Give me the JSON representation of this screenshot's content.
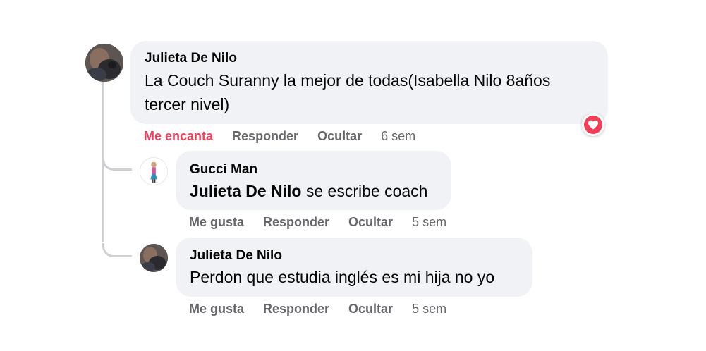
{
  "comments": [
    {
      "author": "Julieta De Nilo",
      "text": "La Couch Suranny la mejor de todas(Isabella Nilo 8años tercer nivel)",
      "actions": {
        "react": "Me encanta",
        "reply": "Responder",
        "hide": "Ocultar",
        "time": "6 sem"
      },
      "reaction_icon": "heart-icon",
      "reaction_color": "#f33e58"
    }
  ],
  "replies": [
    {
      "author": "Gucci Man",
      "mention": "Julieta De Nilo",
      "text": " se escribe coach",
      "actions": {
        "react": "Me gusta",
        "reply": "Responder",
        "hide": "Ocultar",
        "time": "5 sem"
      }
    },
    {
      "author": "Julieta De Nilo",
      "text": "Perdon que estudia inglés es mi hija no yo",
      "actions": {
        "react": "Me gusta",
        "reply": "Responder",
        "hide": "Ocultar",
        "time": "5 sem"
      }
    }
  ],
  "colors": {
    "bubble_bg": "#f0f2f5",
    "muted_text": "#65676b",
    "love_red": "#f33e58",
    "thread_line": "#ced0d4"
  }
}
